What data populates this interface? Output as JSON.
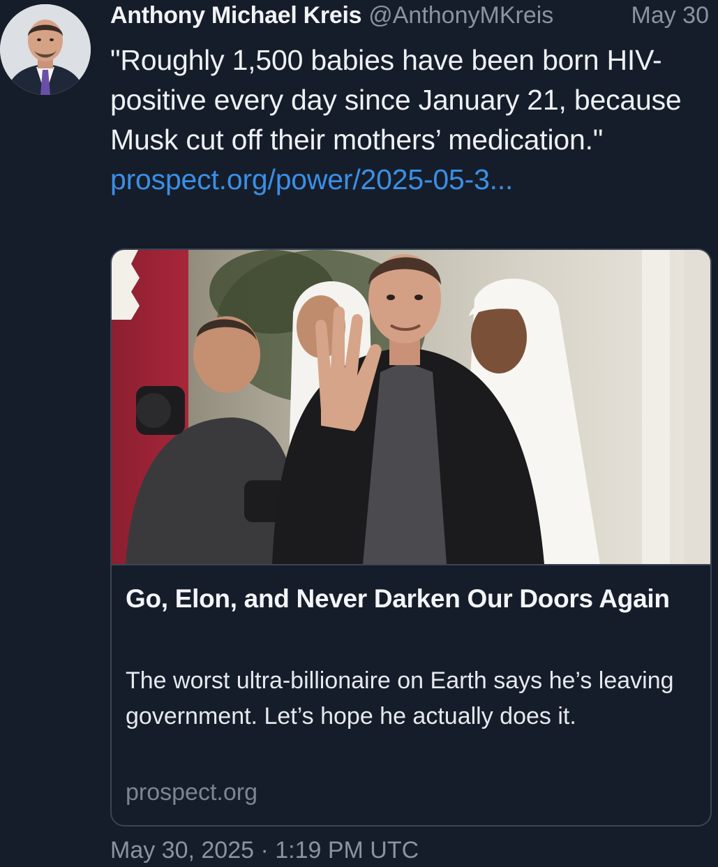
{
  "tweet": {
    "author_name": "Anthony Michael Kreis",
    "author_handle": "@AnthonyMKreis",
    "date_short": "May 30",
    "text": "\"Roughly 1,500 babies have been born HIV-positive every day since January 21, because Musk cut off their mothers’ medication.\"",
    "link_text": "prospect.org/power/2025-05-3...",
    "timestamp": "May 30, 2025 · 1:19 PM UTC"
  },
  "card": {
    "title": "Go, Elon, and Never Darken Our Doors Again",
    "description": "The worst ultra-billionaire on Earth says he’s leaving government. Let’s hope he actually does it.",
    "domain": "prospect.org"
  },
  "colors": {
    "background": "#161d2a",
    "link": "#3a8fe6",
    "muted": "#8a939f",
    "border": "#3a4556"
  }
}
